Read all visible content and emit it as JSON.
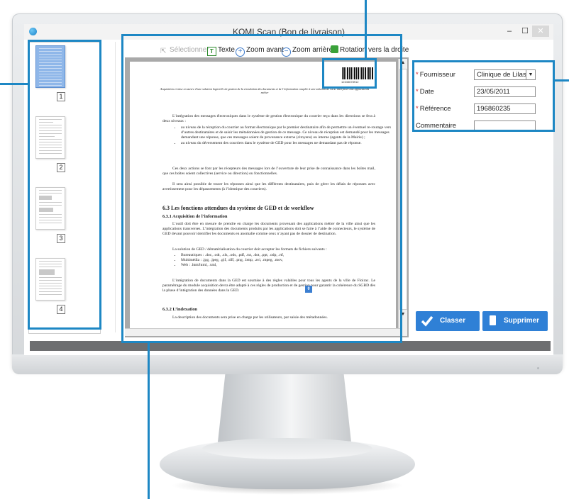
{
  "window": {
    "title": "KOMI Scan (Bon de livraison)",
    "min_glyph": "–",
    "max_glyph": "☐",
    "close_glyph": "✕"
  },
  "thumbnails": [
    {
      "number": "1",
      "selected": true
    },
    {
      "number": "2",
      "selected": false
    },
    {
      "number": "3",
      "selected": false
    },
    {
      "number": "4",
      "selected": false
    }
  ],
  "toolbar": {
    "select": "Sélectionner",
    "text": "Texte",
    "zoom_in": "Zoom avant",
    "zoom_out": "Zoom arrière",
    "rotate_right": "Rotation vers la droite"
  },
  "document": {
    "barcode_number": "12345678912",
    "header": "Acquisition et mise en œuvre d’une solution logicielle de gestion de la circulation des documents et de l’information couplée à une solution de GED interfacée aux applications métier",
    "intro": "L’intégration des messages électroniques dans le système de gestion électronique du courrier reçu dans les directions se fera à deux niveaux :",
    "bullets_1": [
      "au niveau de la réception du courrier au format électronique par le premier destinataire afin de permettre un éventuel re-routage vers d’autres destinataires et de saisir les métadonnées de gestion de ce message. Ce niveau de réception est demandé pour les messages demandant une réponse, que ces messages soient de provenance externe (citoyens) ou interne (agents de la Mairie) ;",
      "au niveau du déversement des courriers dans le système de GED pour les messages ne demandant pas de réponse."
    ],
    "para_2": "Ces deux actions se font par les récepteurs des messages lors de l’ouverture de leur prise de connaissance dans les boîtes mail, que ces boîtes soient collectives (service ou direction) ou fonctionnelles.",
    "para_3": "Il sera ainsi possible de tracer les réponses ainsi que les différents destinataires, puis de gérer les délais de réponses avec avertissement pour les dépassements (à l’identique des courriers).",
    "heading_63": "6.3   Les fonctions attendues du système de GED et de workflow",
    "heading_631": "6.3.1   Acquisition de l’information",
    "para_4": "L’outil doit être en mesure de prendre en charge les documents provenant des applications métier de la ville ainsi que les applications transverses. L’intégration des documents produits par les applications doit se faire à l’aide de connecteurs, le système de GED devant pouvoir identifier les documents en anomalie comme ceux n’ayant pas de dossier de destination.",
    "para_5": "La solution de GED / dématérialisation du courrier doit accepter les formats de fichiers suivants :",
    "bullets_2": [
      "Bureautiques : .doc, .odt, .xls, .ods, .pdf, .txt, .dot, .ppt, .odp, .rtf,",
      "Multimédia : .jpg, .jpeg, .gif, .tiff, .png, .bmp, .avi, .mpeg, .mov,",
      "Web : .htm/html, .xml,"
    ],
    "para_6": "L’intégration de documents dans la GED est soumise à des règles valables pour tous les agents de la ville de Floirac. Le paramétrage du module acquisition devra être adapté à ces règles de production et de gestion pour garantir la cohérence du SGBD dès la phase d’intégration des données dans la GED.",
    "heading_632": "6.3.2   L’indexation",
    "para_7": "La description des documents sera prise en charge par les utilisateurs, par saisie des métadonnées."
  },
  "form": {
    "required_mark": "*",
    "fournisseur_label": "Fournisseur",
    "fournisseur_value": "Clinique de Lilas",
    "date_label": "Date",
    "date_value": "23/05/2011",
    "reference_label": "Référence",
    "reference_value": "196860235",
    "commentaire_label": "Commentaire",
    "commentaire_value": ""
  },
  "actions": {
    "classer": "Classer",
    "supprimer": "Supprimer"
  },
  "colors": {
    "accent": "#1d87c4",
    "button": "#2f80d6"
  }
}
